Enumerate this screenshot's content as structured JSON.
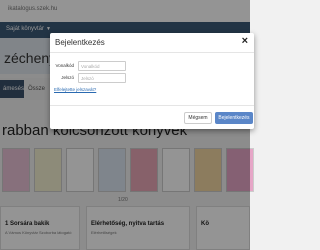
{
  "browser": {
    "url": "ikatalogus.szek.hu"
  },
  "nav": {
    "my_books": "Saját könyvtár"
  },
  "hero": {
    "title_fragment": "zéchenyi Is"
  },
  "tabs": {
    "tab1": "ámesés",
    "tab2": "Össze"
  },
  "section": {
    "title": "rabban kölcsönzött könyvek"
  },
  "books_paging": "1/20",
  "cards": [
    {
      "title": "1 Sorsára bakik",
      "sub": "A Vámos Könyvtár Szoborba látogató"
    },
    {
      "title": "Elérhetőség, nyitva tartás",
      "sub": "Elérhetőségek"
    },
    {
      "title": "Kö",
      "sub": ""
    }
  ],
  "modal": {
    "title": "Bejelentkezés",
    "close_glyph": "×",
    "username_label": "Vonalkód",
    "username_placeholder": "Vonalkód",
    "password_label": "Jelszó",
    "password_placeholder": "Jelszó",
    "forgot_link": "Elfelejtette jelszavát?",
    "cancel_label": "Mégsem",
    "login_label": "Bejelentkezés"
  },
  "colors": {
    "nav": "#3c5a78",
    "primary_button": "#5a86c8",
    "link": "#2a6ab1"
  }
}
